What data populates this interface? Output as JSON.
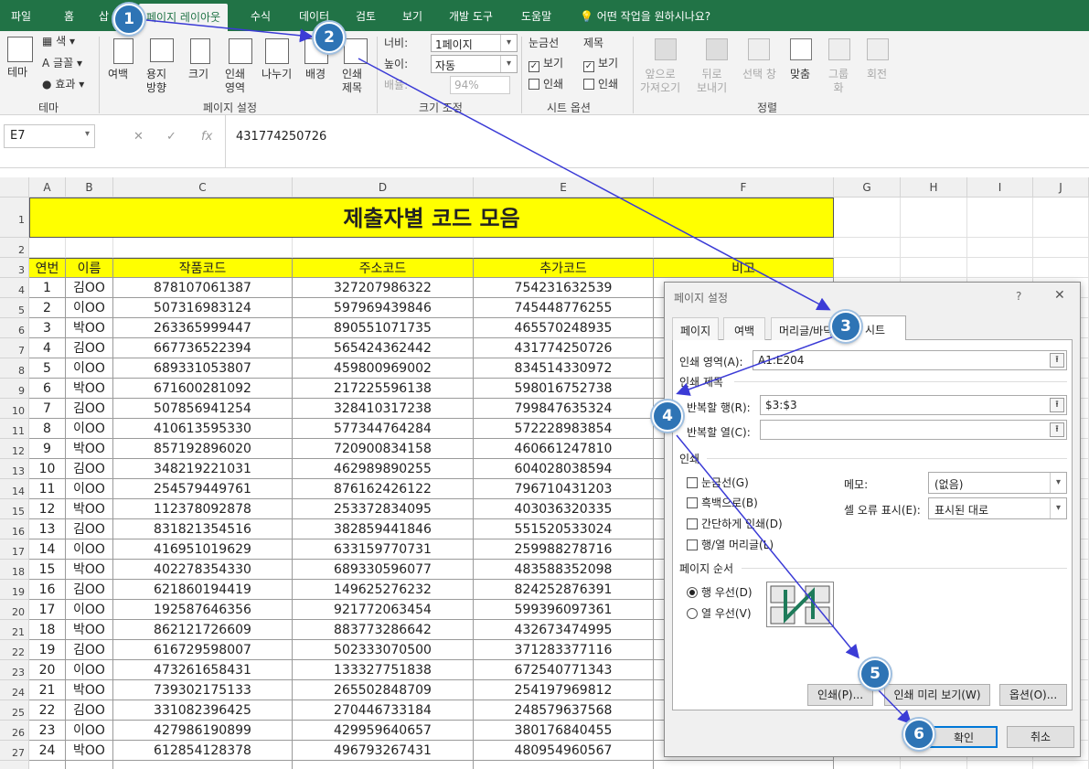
{
  "tabs": [
    "파일",
    "홈",
    "삽",
    "페이지 레이아웃",
    "수식",
    "데이터",
    "검토",
    "보기",
    "개발 도구",
    "도움말",
    "어떤 작업을 원하시나요?"
  ],
  "ribbon": {
    "theme": {
      "main": "테마",
      "colors": "색",
      "fonts": "글꼴",
      "effects": "효과",
      "group": "테마"
    },
    "page_setup": {
      "margins": "여백",
      "orientation": "용지\n방향",
      "size": "크기",
      "print_area": "인쇄\n영역",
      "breaks": "나누기",
      "background": "배경",
      "print_titles": "인쇄\n제목",
      "group": "페이지 설정"
    },
    "scale": {
      "width_label": "너비:",
      "width_val": "1페이지",
      "height_label": "높이:",
      "height_val": "자동",
      "scale_label": "배율:",
      "scale_val": "94%",
      "group": "크기 조정"
    },
    "sheet_options": {
      "gridlines": "눈금선",
      "headings": "제목",
      "view1": "보기",
      "print1": "인쇄",
      "view2": "보기",
      "print2": "인쇄",
      "group": "시트 옵션"
    },
    "arrange": {
      "bring_forward": "앞으로\n가져오기",
      "send_backward": "뒤로\n보내기",
      "selection_pane": "선택 창",
      "align": "맞춤",
      "group_btn": "그룹\n화",
      "rotate": "회전",
      "group": "정렬"
    }
  },
  "formula_bar": {
    "name_box": "E7",
    "value": "431774250726"
  },
  "columns": [
    "A",
    "B",
    "C",
    "D",
    "E",
    "F",
    "G",
    "H",
    "I",
    "J"
  ],
  "sheet_title": "제출자별 코드 모음",
  "headers": [
    "연번",
    "이름",
    "작품코드",
    "주소코드",
    "추가코드",
    "비고"
  ],
  "rows": [
    [
      "1",
      "김OO",
      "878107061387",
      "327207986322",
      "754231632539"
    ],
    [
      "2",
      "이OO",
      "507316983124",
      "597969439846",
      "745448776255"
    ],
    [
      "3",
      "박OO",
      "263365999447",
      "890551071735",
      "465570248935"
    ],
    [
      "4",
      "김OO",
      "667736522394",
      "565424362442",
      "431774250726"
    ],
    [
      "5",
      "이OO",
      "689331053807",
      "459800969002",
      "834514330972"
    ],
    [
      "6",
      "박OO",
      "671600281092",
      "217225596138",
      "598016752738"
    ],
    [
      "7",
      "김OO",
      "507856941254",
      "328410317238",
      "799847635324"
    ],
    [
      "8",
      "이OO",
      "410613595330",
      "577344764284",
      "572228983854"
    ],
    [
      "9",
      "박OO",
      "857192896020",
      "720900834158",
      "460661247810"
    ],
    [
      "10",
      "김OO",
      "348219221031",
      "462989890255",
      "604028038594"
    ],
    [
      "11",
      "이OO",
      "254579449761",
      "876162426122",
      "796710431203"
    ],
    [
      "12",
      "박OO",
      "112378092878",
      "253372834095",
      "403036320335"
    ],
    [
      "13",
      "김OO",
      "831821354516",
      "382859441846",
      "551520533024"
    ],
    [
      "14",
      "이OO",
      "416951019629",
      "633159770731",
      "259988278716"
    ],
    [
      "15",
      "박OO",
      "402278354330",
      "689330596077",
      "483588352098"
    ],
    [
      "16",
      "김OO",
      "621860194419",
      "149625276232",
      "824252876391"
    ],
    [
      "17",
      "이OO",
      "192587646356",
      "921772063454",
      "599396097361"
    ],
    [
      "18",
      "박OO",
      "862121726609",
      "883773286642",
      "432673474995"
    ],
    [
      "19",
      "김OO",
      "616729598007",
      "502333070500",
      "371283377116"
    ],
    [
      "20",
      "이OO",
      "473261658431",
      "133327751838",
      "672540771343"
    ],
    [
      "21",
      "박OO",
      "739302175133",
      "265502848709",
      "254197969812"
    ],
    [
      "22",
      "김OO",
      "331082396425",
      "270446733184",
      "248579637568"
    ],
    [
      "23",
      "이OO",
      "427986190899",
      "429959640657",
      "380176840455"
    ],
    [
      "24",
      "박OO",
      "612854128378",
      "496793267431",
      "480954960567"
    ]
  ],
  "dialog": {
    "title": "페이지 설정",
    "help": "?",
    "close": "✕",
    "tabs": [
      "페이지",
      "여백",
      "머리글/바닥글",
      "시트"
    ],
    "print_area_label": "인쇄 영역(A):",
    "print_area_val": "A1:E204",
    "print_titles_section": "인쇄 제목",
    "rows_repeat_label": "반복할 행(R):",
    "rows_repeat_val": "$3:$3",
    "cols_repeat_label": "반복할 열(C):",
    "cols_repeat_val": "",
    "print_section": "인쇄",
    "gridlines": "눈금선(G)",
    "bw": "흑백으로(B)",
    "draft": "간단하게 인쇄(D)",
    "headings": "행/열 머리글(L)",
    "comments_label": "메모:",
    "comments_val": "(없음)",
    "errors_label": "셀 오류 표시(E):",
    "errors_val": "표시된 대로",
    "order_section": "페이지 순서",
    "down_then_over": "행 우선(D)",
    "over_then_down": "열 우선(V)",
    "btn_print": "인쇄(P)...",
    "btn_preview": "인쇄 미리 보기(W)",
    "btn_options": "옵션(O)...",
    "btn_ok": "확인",
    "btn_cancel": "취소"
  },
  "steps": [
    "1",
    "2",
    "3",
    "4",
    "5",
    "6"
  ],
  "colors": {
    "excel_green": "#217346",
    "title_fill": "#ffff00",
    "header_fill": "#ffff00",
    "badge": "#2e74b5",
    "arrow": "#3b3bd6"
  }
}
